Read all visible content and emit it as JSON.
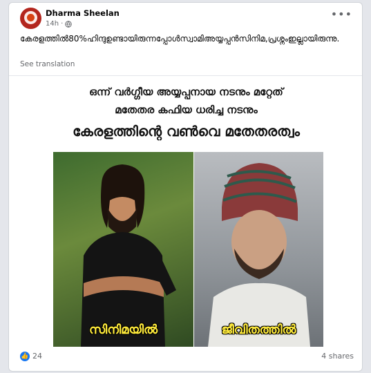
{
  "post": {
    "author": "Dharma Sheelan",
    "time": "14h",
    "text": "കേരളത്തിൽ80%ഹിന്ദുഉണ്ടായിരുന്നപ്പോൾസ്വാമിഅയ്യപ്പൻസിനിമ,പ്രശ്നംഇല്ലായിരുന്നു.",
    "see_translation": "See translation",
    "more": "•••"
  },
  "image": {
    "line1": "ഒന്ന് വർഗ്ഗീയ അയ്യപ്പനായ നടനും മറ്റേത്",
    "line2": "മതേതര കഫിയ ധരിച്ച നടനും",
    "line3": "കേരളത്തിന്റെ വൺവെ മതേതരത്വം",
    "caption_left": "സിനിമയിൽ",
    "caption_right": "ജീവിതത്തിൽ"
  },
  "footer": {
    "reactions_count": "24",
    "shares": "4 shares",
    "like_glyph": "👍"
  },
  "colors": {
    "accent": "#1877f2",
    "caption": "#ffeb3b"
  }
}
